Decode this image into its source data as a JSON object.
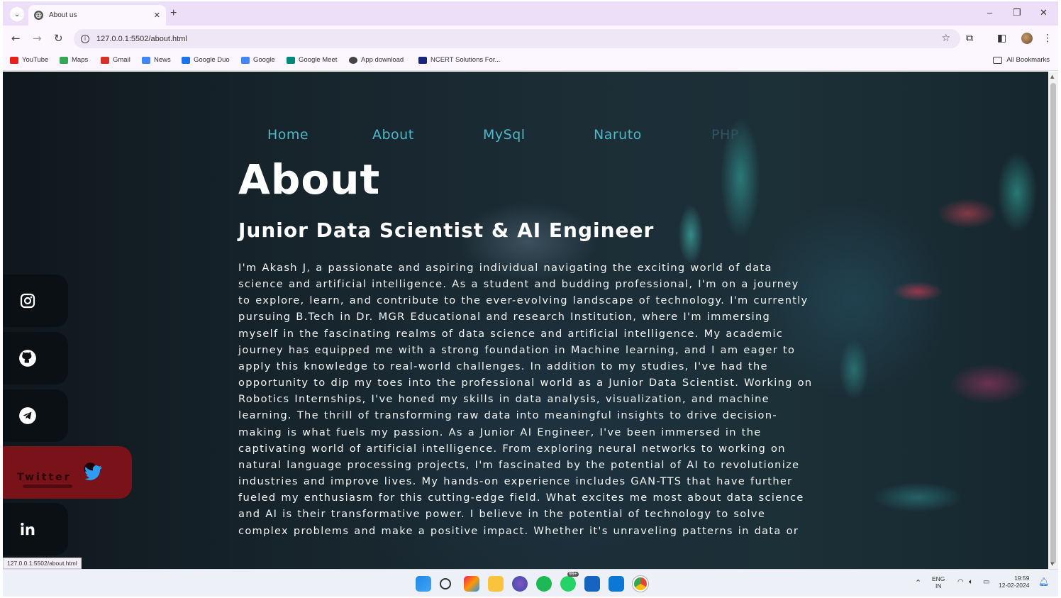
{
  "browser": {
    "tab_title": "About us",
    "new_tab": "+",
    "url": "127.0.0.1:5502/about.html",
    "status_url": "127.0.0.1:5502/about.html",
    "window_controls": {
      "minimize": "–",
      "restore": "❐",
      "close": "✕"
    }
  },
  "bookmarks": [
    {
      "label": "YouTube",
      "color": "#e62117"
    },
    {
      "label": "Maps",
      "color": "#34a853"
    },
    {
      "label": "Gmail",
      "color": "#d93025"
    },
    {
      "label": "News",
      "color": "#4285f4"
    },
    {
      "label": "Google Duo",
      "color": "#1a73e8"
    },
    {
      "label": "Google",
      "color": "#4285f4"
    },
    {
      "label": "Google Meet",
      "color": "#00897b"
    },
    {
      "label": "App download",
      "color": "#444444"
    },
    {
      "label": "NCERT Solutions For...",
      "color": "#1a237e"
    }
  ],
  "all_bookmarks": "All Bookmarks",
  "site": {
    "nav": [
      "Home",
      "About",
      "MySql",
      "Naruto",
      "PHP"
    ],
    "heading": "About",
    "subheading": "Junior Data Scientist & AI Engineer",
    "bio": "I'm Akash J, a passionate and aspiring individual navigating the exciting world of data science and artificial intelligence. As a student and budding professional, I'm on a journey to explore, learn, and contribute to the ever-evolving landscape of technology. I'm currently pursuing B.Tech in Dr. MGR Educational and research Institution, where I'm immersing myself in the fascinating realms of data science and artificial intelligence. My academic journey has equipped me with a strong foundation in Machine learning, and I am eager to apply this knowledge to real-world challenges. In addition to my studies, I've had the opportunity to dip my toes into the professional world as a Junior Data Scientist. Working on Robotics Internships, I've honed my skills in data analysis, visualization, and machine learning. The thrill of transforming raw data into meaningful insights to drive decision-making is what fuels my passion. As a Junior AI Engineer, I've been immersed in the captivating world of artificial intelligence. From exploring neural networks to working on natural language processing projects, I'm fascinated by the potential of AI to revolutionize industries and improve lives. My hands-on experience includes GAN-TTS that have further fueled my enthusiasm for this cutting-edge field. What excites me most about data science and AI is their transformative power. I believe in the potential of technology to solve complex problems and make a positive impact. Whether it's unraveling patterns in data or",
    "social": {
      "twitter_label": "Twitter",
      "items": [
        "instagram",
        "github",
        "telegram",
        "twitter",
        "linkedin"
      ]
    },
    "accent_color": "#4fb7c7",
    "twitter_color": "#7a1219"
  },
  "taskbar": {
    "language": "ENG",
    "region": "IN",
    "time": "19:59",
    "date": "12-02-2024",
    "badge": "99+"
  }
}
